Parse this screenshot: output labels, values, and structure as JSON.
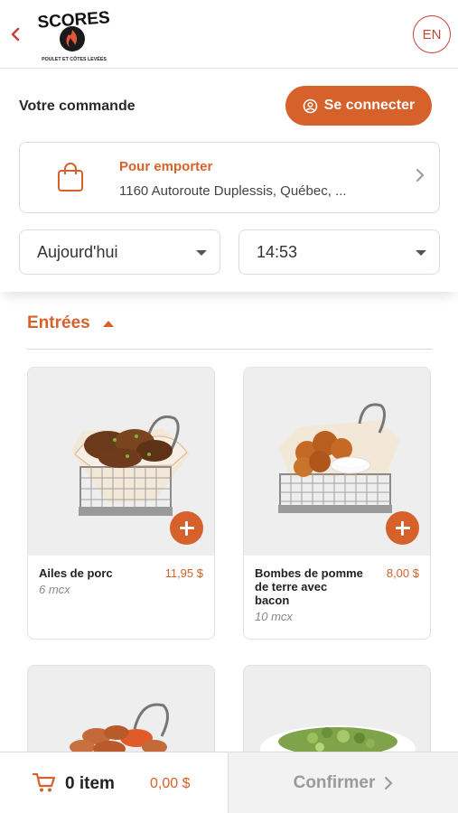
{
  "header": {
    "logo_text": "SCORES",
    "logo_tagline": "POULET ET CÔTES LEVÉES",
    "language": "EN"
  },
  "order": {
    "title": "Votre commande",
    "login_label": "Se connecter",
    "mode": "Pour emporter",
    "address": "1160 Autoroute Duplessis, Québec, ...",
    "day": "Aujourd'hui",
    "time": "14:53"
  },
  "section": {
    "title": "Entrées"
  },
  "products": [
    {
      "name": "Ailes de porc",
      "price": "11,95 $",
      "qty": "6 mcx"
    },
    {
      "name": "Bombes de pomme de terre avec bacon",
      "price": "8,00 $",
      "qty": "10 mcx"
    }
  ],
  "cart": {
    "count": "0 item",
    "total": "0,00 $",
    "confirm_label": "Confirmer"
  },
  "colors": {
    "accent": "#d6612b",
    "logo_red": "#c5443a"
  }
}
